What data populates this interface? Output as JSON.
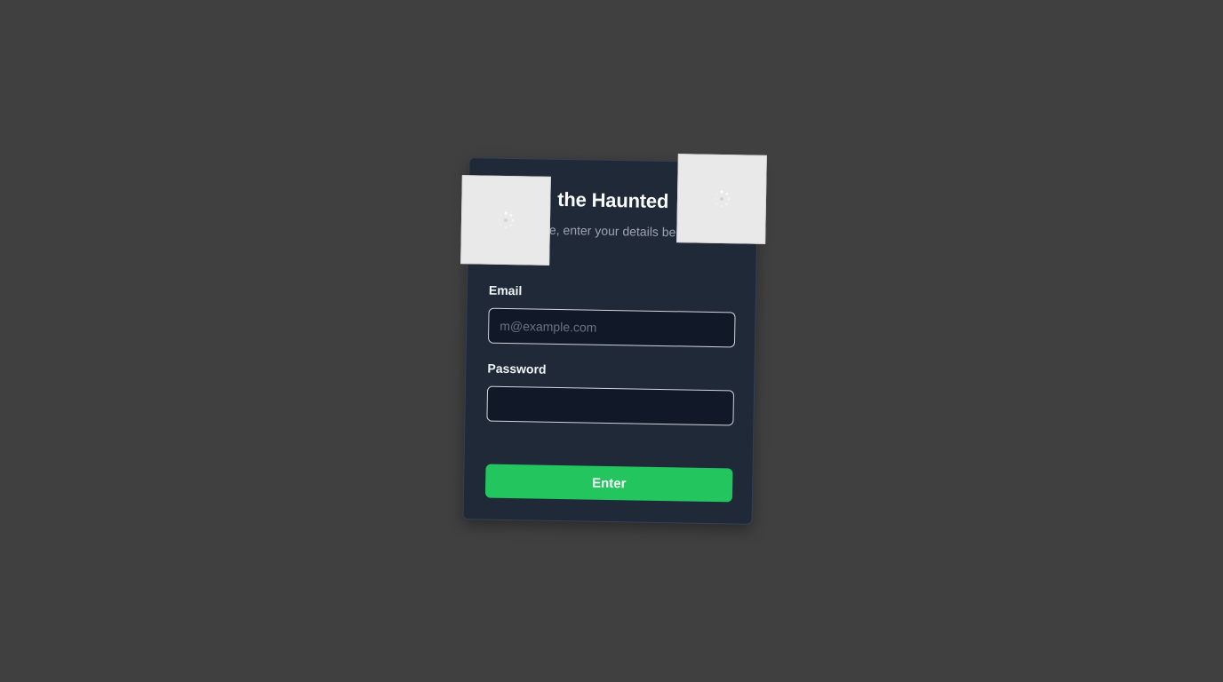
{
  "login_card": {
    "title": "the Haunted",
    "subtitle": "e, enter your details be",
    "email": {
      "label": "Email",
      "placeholder": "m@example.com",
      "value": ""
    },
    "password": {
      "label": "Password",
      "value": ""
    },
    "submit_label": "Enter"
  },
  "overlays": {
    "left_icon": "spinner-icon",
    "right_icon": "spinner-icon"
  },
  "colors": {
    "page_background": "#404040",
    "card_background": "#1f2937",
    "input_background": "#111827",
    "accent": "#22c55e",
    "overlay_tile": "#e9e9e9"
  }
}
